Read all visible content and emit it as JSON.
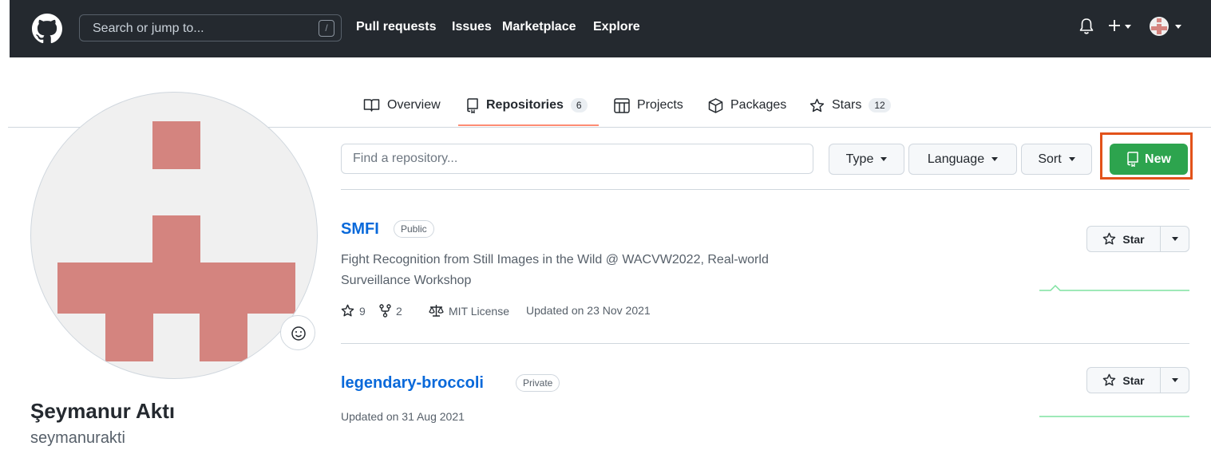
{
  "header": {
    "search_placeholder": "Search or jump to...",
    "search_shortcut": "/",
    "nav": [
      "Pull requests",
      "Issues",
      "Marketplace",
      "Explore"
    ]
  },
  "tabs": [
    {
      "label": "Overview",
      "icon": "book-icon"
    },
    {
      "label": "Repositories",
      "icon": "repo-icon",
      "count": "6"
    },
    {
      "label": "Projects",
      "icon": "project-icon"
    },
    {
      "label": "Packages",
      "icon": "package-icon"
    },
    {
      "label": "Stars",
      "icon": "star-icon",
      "count": "12"
    }
  ],
  "profile": {
    "name": "Şeymanur Aktı",
    "login": "seymanurakti"
  },
  "filters": {
    "find_placeholder": "Find a repository...",
    "type_label": "Type",
    "language_label": "Language",
    "sort_label": "Sort",
    "new_label": "New"
  },
  "repos": [
    {
      "name": "SMFI",
      "visibility": "Public",
      "description_line1": "Fight Recognition from Still Images in the Wild @ WACVW2022, Real-world",
      "description_line2": "Surveillance Workshop",
      "stars": "9",
      "forks": "2",
      "license": "MIT License",
      "updated": "Updated on 23 Nov 2021",
      "star_label": "Star"
    },
    {
      "name": "legendary-broccoli",
      "visibility": "Private",
      "updated": "Updated on 31 Aug 2021",
      "star_label": "Star"
    }
  ],
  "colors": {
    "header_bg": "#24292f",
    "link": "#0969da",
    "new_button": "#2da44e",
    "tab_underline": "#fd8c73",
    "highlight": "#e2521a",
    "avatar": "#d4847f",
    "spark": "#7ee2a0"
  }
}
